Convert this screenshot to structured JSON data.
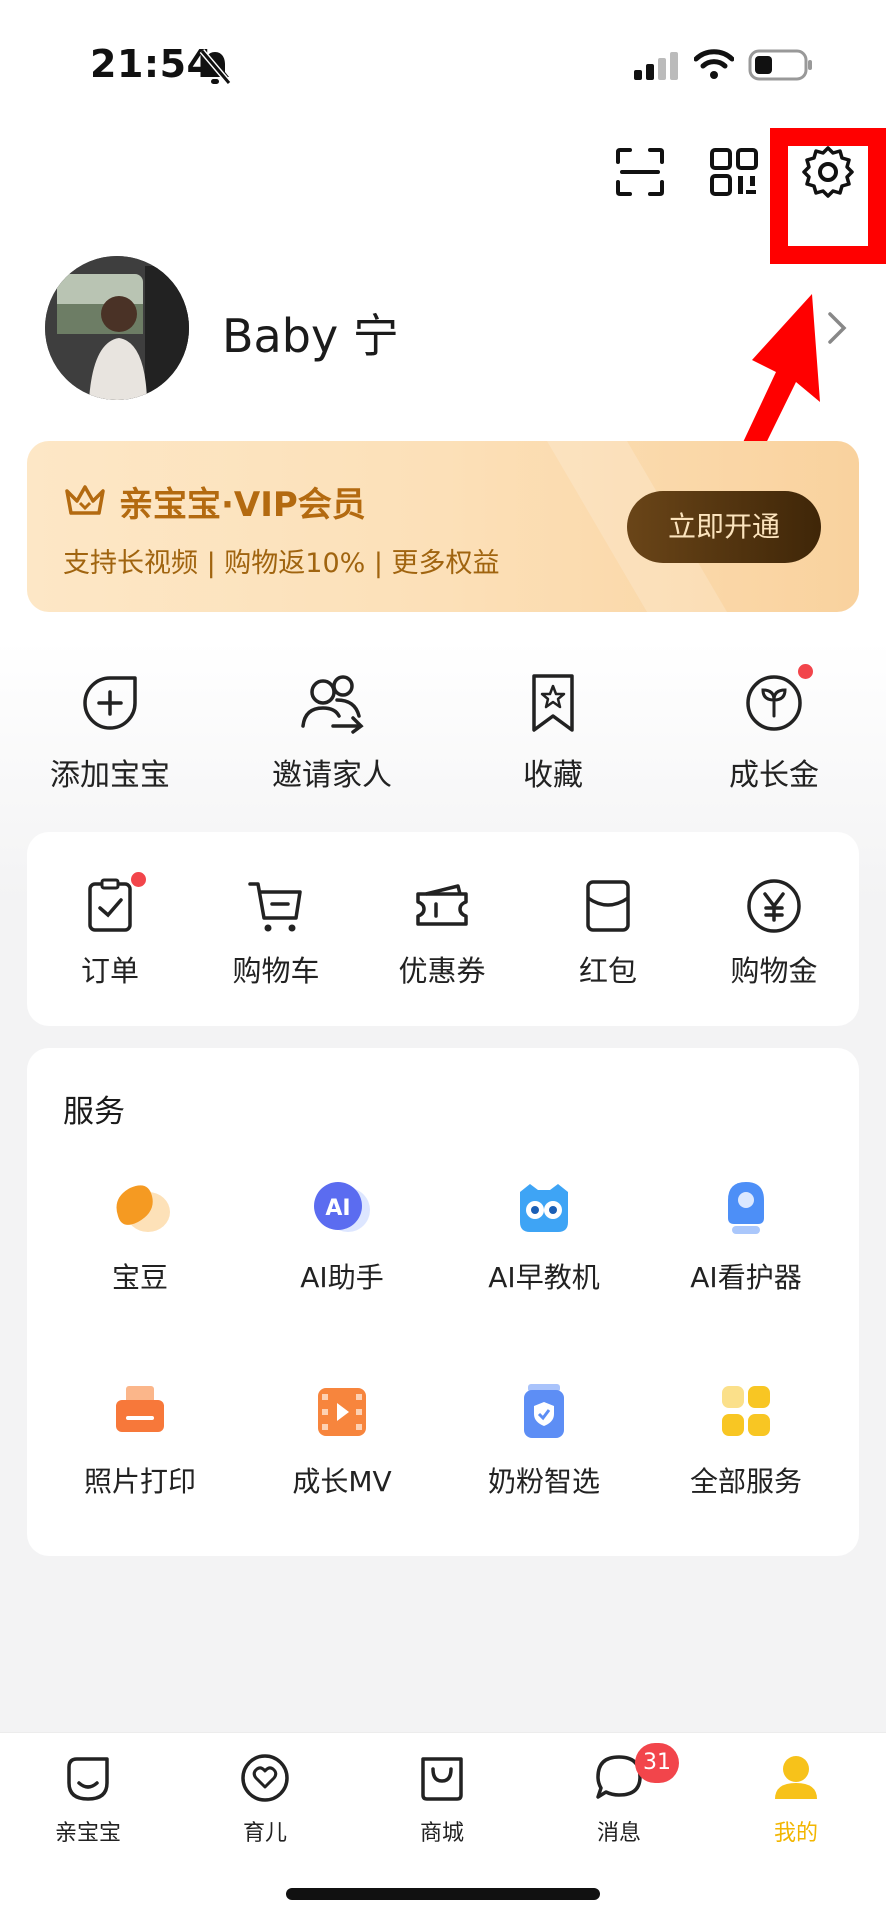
{
  "status_bar": {
    "time": "21:54"
  },
  "profile": {
    "name": "Baby 宁"
  },
  "vip": {
    "title": "亲宝宝·VIP会员",
    "subtitle": "支持长视频 | 购物返10% | 更多权益",
    "button_label": "立即开通"
  },
  "quick_actions": [
    {
      "label": "添加宝宝",
      "icon": "add-baby-icon"
    },
    {
      "label": "邀请家人",
      "icon": "invite-family-icon"
    },
    {
      "label": "收藏",
      "icon": "favorite-icon"
    },
    {
      "label": "成长金",
      "icon": "growth-fund-icon"
    }
  ],
  "orders": [
    {
      "label": "订单",
      "icon": "order-icon"
    },
    {
      "label": "购物车",
      "icon": "cart-icon"
    },
    {
      "label": "优惠券",
      "icon": "coupon-icon"
    },
    {
      "label": "红包",
      "icon": "red-packet-icon"
    },
    {
      "label": "购物金",
      "icon": "shopping-gold-icon"
    }
  ],
  "services": {
    "title": "服务",
    "items": [
      {
        "label": "宝豆",
        "icon": "bean-icon"
      },
      {
        "label": "AI助手",
        "icon": "ai-assistant-icon"
      },
      {
        "label": "AI早教机",
        "icon": "ai-early-learning-icon"
      },
      {
        "label": "AI看护器",
        "icon": "ai-monitor-icon"
      },
      {
        "label": "照片打印",
        "icon": "photo-print-icon"
      },
      {
        "label": "成长MV",
        "icon": "growth-mv-icon"
      },
      {
        "label": "奶粉智选",
        "icon": "milk-select-icon"
      },
      {
        "label": "全部服务",
        "icon": "all-services-icon"
      }
    ]
  },
  "tabbar": {
    "items": [
      {
        "label": "亲宝宝",
        "icon": "home-icon"
      },
      {
        "label": "育儿",
        "icon": "parenting-icon"
      },
      {
        "label": "商城",
        "icon": "mall-icon"
      },
      {
        "label": "消息",
        "icon": "message-icon",
        "badge": "31"
      },
      {
        "label": "我的",
        "icon": "me-icon",
        "active": true
      }
    ]
  },
  "colors": {
    "accent": "#f2b600",
    "badge": "#f2454b",
    "vip_text": "#b36a10",
    "highlight": "#ff0000"
  }
}
